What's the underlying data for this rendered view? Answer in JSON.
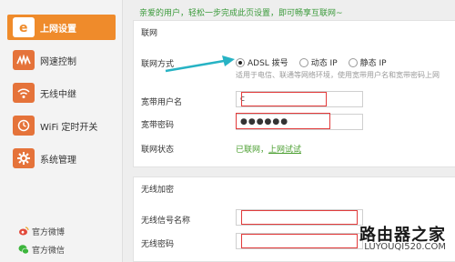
{
  "sidebar": {
    "items": [
      {
        "label": "上网设置",
        "icon": "globe-e-icon",
        "active": true
      },
      {
        "label": "网速控制",
        "icon": "speed-wave-icon",
        "active": false
      },
      {
        "label": "无线中继",
        "icon": "wireless-relay-icon",
        "active": false
      },
      {
        "label": "WiFi 定时开关",
        "icon": "wifi-timer-icon",
        "active": false
      },
      {
        "label": "系统管理",
        "icon": "gear-icon",
        "active": false
      }
    ],
    "bottom_links": [
      {
        "label": "官方微博",
        "icon": "weibo-icon"
      },
      {
        "label": "官方微信",
        "icon": "wechat-icon"
      }
    ]
  },
  "main": {
    "notice": "亲爱的用户，轻松一步完成此页设置，即可畅享互联网~",
    "internet_section": {
      "title": "联网",
      "method_label": "联网方式",
      "options": [
        {
          "label": "ADSL 拨号",
          "checked": true
        },
        {
          "label": "动态 IP",
          "checked": false
        },
        {
          "label": "静态 IP",
          "checked": false
        }
      ],
      "hint": "适用于电信、联通等网络环境，使用宽带用户名和宽带密码上网",
      "username_label": "宽带用户名",
      "username_value": "c",
      "password_label": "宽带密码",
      "password_value": "●●●●●●",
      "status_label": "联网状态",
      "status_text": "已联网，",
      "status_link": "上网试试"
    },
    "wireless_section": {
      "title": "无线加密",
      "ssid_label": "无线信号名称",
      "ssid_value": "",
      "password_label": "无线密码",
      "password_value": ""
    }
  },
  "watermark": {
    "cn": "路由器之家",
    "en": "LUYOUQI520.COM"
  },
  "colors": {
    "accent": "#ef8b2b",
    "status_green": "#4a9e2f",
    "highlight_red": "#e23b3b",
    "arrow_teal": "#27b3c4"
  }
}
